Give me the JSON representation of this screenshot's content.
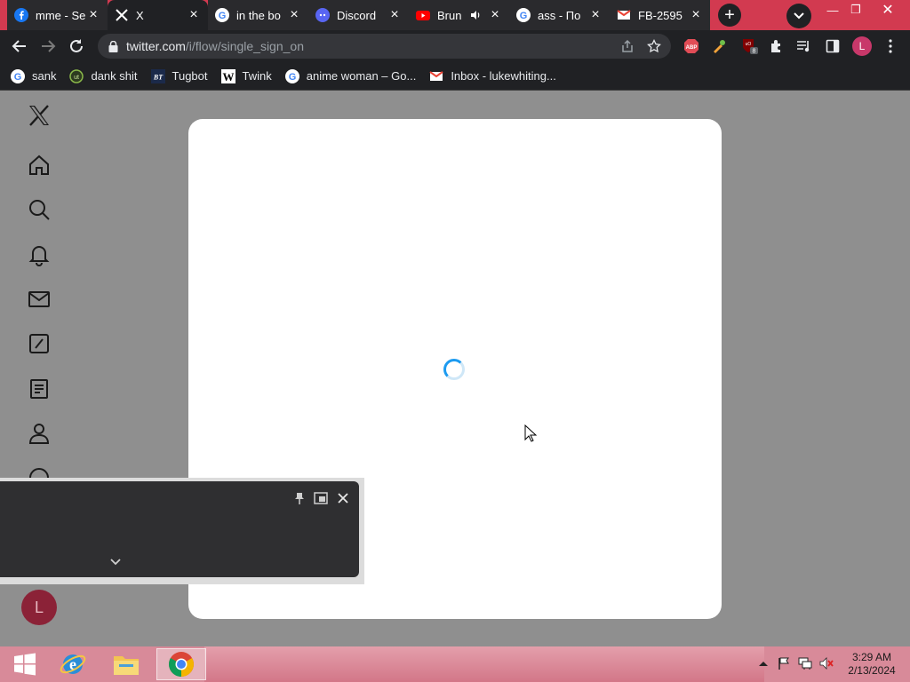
{
  "tabs": [
    {
      "title": "mme - Se",
      "favicon": "facebook-icon"
    },
    {
      "title": "X",
      "favicon": "x-logo-icon"
    },
    {
      "title": "in the bo",
      "favicon": "google-icon"
    },
    {
      "title": "Discord",
      "favicon": "discord-icon"
    },
    {
      "title": "Brun",
      "favicon": "youtube-icon"
    },
    {
      "title": "ass - По",
      "favicon": "google-icon"
    },
    {
      "title": "FB-2595",
      "favicon": "gmail-icon"
    }
  ],
  "address_bar": {
    "host": "twitter.com",
    "path": "/i/flow/single_sign_on"
  },
  "profile_initial": "L",
  "extension_badge": "8",
  "bookmarks": [
    {
      "label": "sank",
      "icon": "google-icon"
    },
    {
      "label": "dank shit",
      "icon": "globe-icon"
    },
    {
      "label": "Tugbot",
      "icon": "bt-icon"
    },
    {
      "label": "Twink",
      "icon": "w-icon"
    },
    {
      "label": "anime woman – Go...",
      "icon": "google-icon"
    },
    {
      "label": "Inbox - lukewhiting...",
      "icon": "gmail-icon"
    }
  ],
  "page": {
    "account_initial": "L"
  },
  "taskbar": {
    "time": "3:29 AM",
    "date": "2/13/2024"
  },
  "colors": {
    "tabstrip": "#d23a50",
    "toolbar": "#202124",
    "twitter_blue": "#1d9bf0",
    "overlay_gray": "#8f8f8f"
  }
}
